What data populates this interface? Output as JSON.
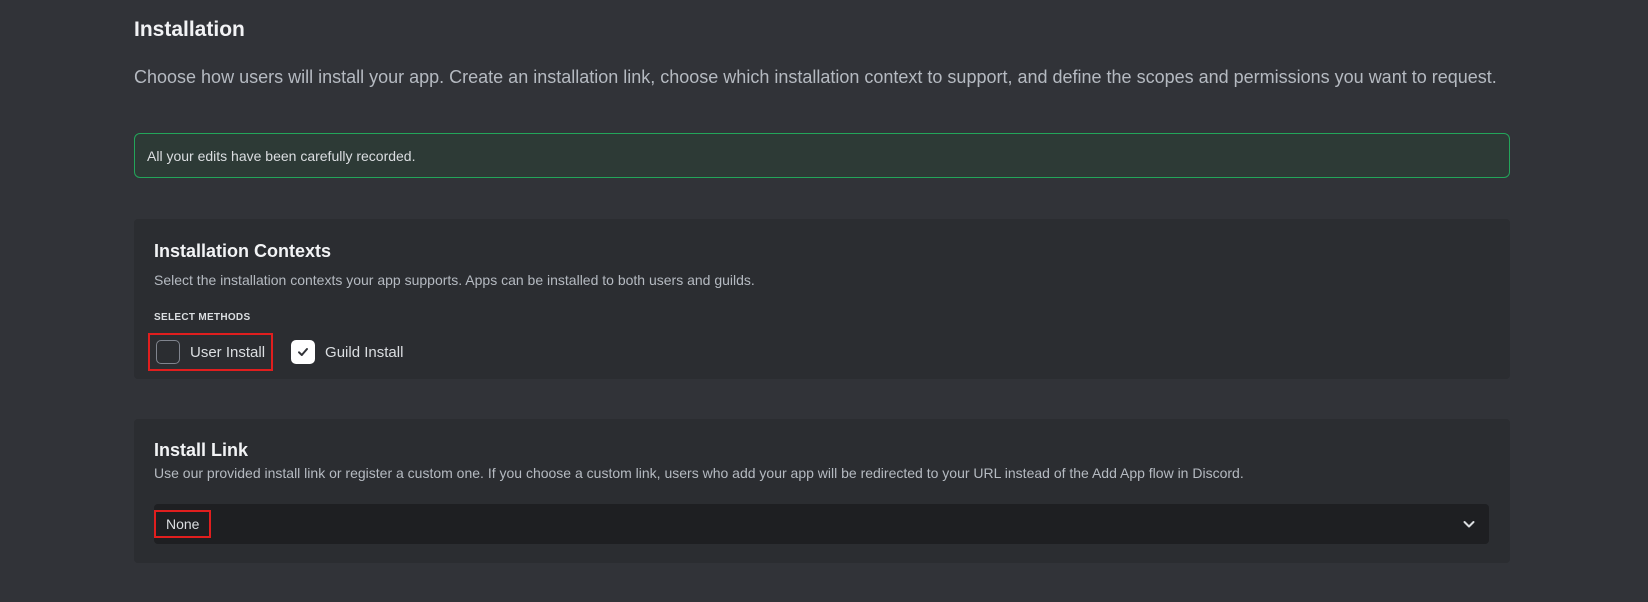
{
  "page": {
    "title": "Installation",
    "description": "Choose how users will install your app. Create an installation link, choose which installation context to support, and define the scopes and permissions you want to request."
  },
  "notice": {
    "text": "All your edits have been carefully recorded."
  },
  "contexts": {
    "title": "Installation Contexts",
    "description": "Select the installation contexts your app supports. Apps can be installed to both users and guilds.",
    "label": "SELECT METHODS",
    "options": [
      {
        "label": "User Install",
        "checked": false
      },
      {
        "label": "Guild Install",
        "checked": true
      }
    ]
  },
  "install_link": {
    "title": "Install Link",
    "description": "Use our provided install link or register a custom one. If you choose a custom link, users who add your app will be redirected to your URL instead of the Add App flow in Discord.",
    "selected": "None",
    "chevron_icon": "chevron-down-icon"
  },
  "colors": {
    "background": "#313338",
    "card": "#2b2d31",
    "notice_border": "#23a55a",
    "highlight": "#e01e1e"
  }
}
